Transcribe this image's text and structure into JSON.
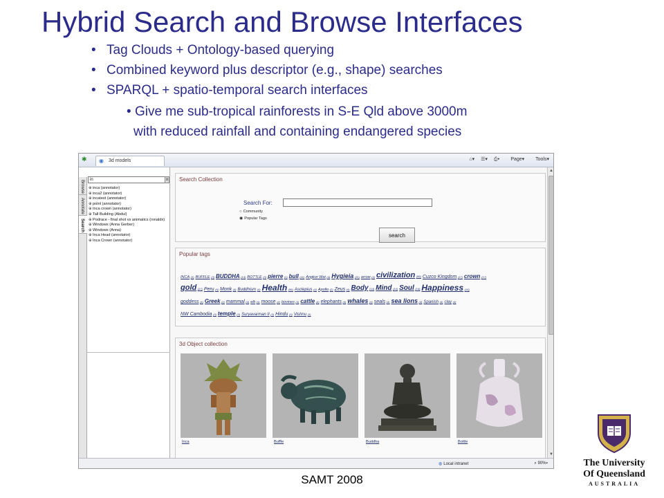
{
  "slide": {
    "title": "Hybrid Search and Browse Interfaces",
    "bullets": [
      "Tag Clouds + Ontology-based querying",
      "Combined keyword plus descriptor (e.g., shape) searches",
      "SPARQL + spatio-temporal search interfaces"
    ],
    "sub_bullet_line1": "Give me sub-tropical rainforests in S-E Qld above 3000m",
    "sub_bullet_line2": "with reduced rainfall  and containing endangered species",
    "footer": "SAMT 2008"
  },
  "logo": {
    "line1": "The University",
    "line2": "Of Queensland",
    "line3": "AUSTRALIA"
  },
  "browser": {
    "tab_title": "3d models",
    "toolbar": {
      "page_label": "Page",
      "tools_label": "Tools"
    },
    "status": {
      "zone": "Local intranet",
      "zoom": "90%"
    }
  },
  "left_pane": {
    "tabs": [
      "Browse",
      "Annotate",
      "Search"
    ],
    "active_tab": "Search",
    "search_value": "in",
    "tree_items": [
      "inca (annotator)",
      "inca2 (annotator)",
      "incatest (annotator)",
      "point (annotator)",
      "Inca crown (annotator)",
      "Tall Building (Abdul)",
      "Podrace - final shot vs animatics (ronaldx)",
      "Windows (Anna Gerber)",
      "Windows (Anna)",
      "Inca Head (annotator)",
      "Inca Crown (annotator)"
    ]
  },
  "search_collection": {
    "title": "Search Collection",
    "search_for_label": "Search For:",
    "search_value": "",
    "radio_community": "Community",
    "radio_popular": "Popular Tags",
    "button": "search"
  },
  "popular_tags": {
    "title": "Popular tags",
    "lines": [
      [
        {
          "t": "INCA",
          "c": "(3)",
          "s": 5.5
        },
        {
          "t": "BUFFLE",
          "c": "(3)",
          "s": 5.5
        },
        {
          "t": "BUDDHA",
          "c": "(14)",
          "s": 8
        },
        {
          "t": "BOTTLE",
          "c": "(3)",
          "s": 5.5
        },
        {
          "t": "pierre",
          "c": "(1)",
          "s": 8
        },
        {
          "t": "bull",
          "c": "(11)",
          "s": 8
        },
        {
          "t": "Angkor Wat",
          "c": "(4)",
          "s": 5.5
        },
        {
          "t": "Hygieia",
          "c": "(31)",
          "s": 9
        },
        {
          "t": "arrow",
          "c": "(4)",
          "s": 5.5
        },
        {
          "t": "civilization",
          "c": "(56)",
          "s": 11
        },
        {
          "t": "Cuzco Kingdom",
          "c": "(17)",
          "s": 7
        },
        {
          "t": "crown",
          "c": "(17)",
          "s": 8
        }
      ],
      [
        {
          "t": "gold",
          "c": "(17)",
          "s": 11
        },
        {
          "t": "Peru",
          "c": "(6)",
          "s": 7
        },
        {
          "t": "Monk",
          "c": "(4)",
          "s": 7
        },
        {
          "t": "Buddhism",
          "c": "(4)",
          "s": 6
        },
        {
          "t": "Health",
          "c": "(56)",
          "s": 12
        },
        {
          "t": "Asclepius",
          "c": "(4)",
          "s": 6
        },
        {
          "t": "Apollo",
          "c": "(2)",
          "s": 5.5
        },
        {
          "t": "Zeus",
          "c": "(4)",
          "s": 7
        },
        {
          "t": "Body",
          "c": "(14)",
          "s": 10
        },
        {
          "t": "Mind",
          "c": "(14)",
          "s": 10
        },
        {
          "t": "Soul",
          "c": "(14)",
          "s": 10
        },
        {
          "t": "Happiness",
          "c": "(14)",
          "s": 12
        }
      ],
      [
        {
          "t": "goddess",
          "c": "(4)",
          "s": 7
        },
        {
          "t": "Greek",
          "c": "(4)",
          "s": 8
        },
        {
          "t": "mammal",
          "c": "(4)",
          "s": 7
        },
        {
          "t": "elk",
          "c": "(4)",
          "s": 5.5
        },
        {
          "t": "moose",
          "c": "(4)",
          "s": 7
        },
        {
          "t": "bovines",
          "c": "(4)",
          "s": 5.5
        },
        {
          "t": "cattle",
          "c": "(4)",
          "s": 8
        },
        {
          "t": "elephants",
          "c": "(4)",
          "s": 7
        },
        {
          "t": "whales",
          "c": "(4)",
          "s": 9
        },
        {
          "t": "seals",
          "c": "(4)",
          "s": 7
        },
        {
          "t": "sea lions",
          "c": "(4)",
          "s": 9
        },
        {
          "t": "Spanish",
          "c": "(4)",
          "s": 6
        },
        {
          "t": "clay",
          "c": "(4)",
          "s": 6
        }
      ],
      [
        {
          "t": "NW Cambodia",
          "c": "(3)",
          "s": 7
        },
        {
          "t": "temple",
          "c": "(3)",
          "s": 8
        },
        {
          "t": "Suryavarman II",
          "c": "(3)",
          "s": 6
        },
        {
          "t": "Hindu",
          "c": "(3)",
          "s": 7
        },
        {
          "t": "Vishnu",
          "c": "(3)",
          "s": 6
        }
      ]
    ]
  },
  "object_collection": {
    "title": "3d Object collection",
    "items": [
      {
        "label": "Inca",
        "icon": "inca-statue-icon"
      },
      {
        "label": "Buffle",
        "icon": "buffalo-vessel-icon"
      },
      {
        "label": "Buddha",
        "icon": "buddha-statue-icon"
      },
      {
        "label": "Bottle",
        "icon": "bottle-vase-icon"
      }
    ]
  }
}
